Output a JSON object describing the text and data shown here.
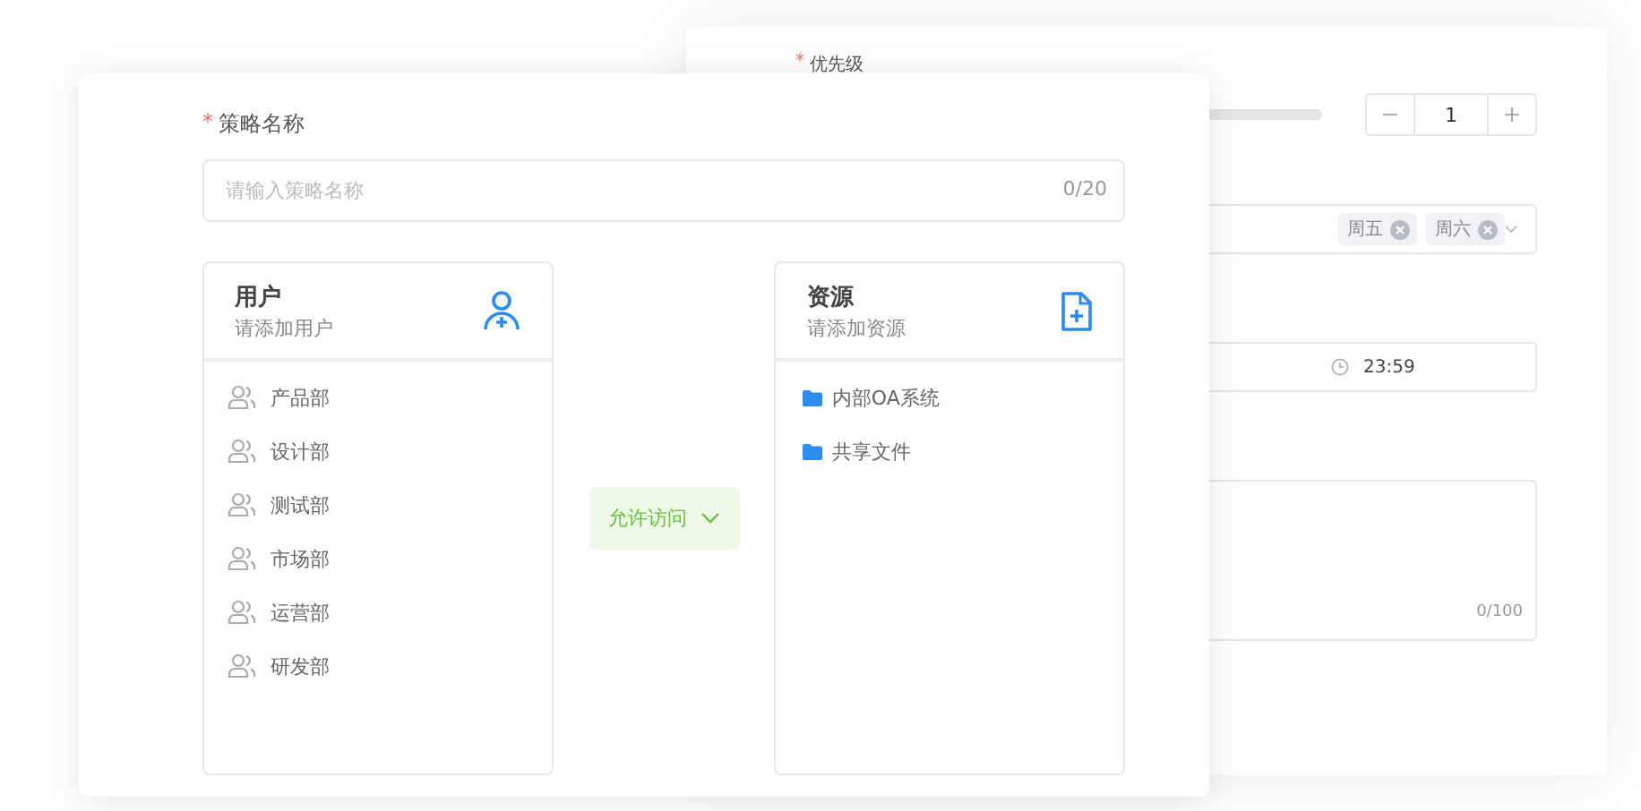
{
  "back_panel": {
    "priority_label": {
      "mark": "*",
      "text": "优先级"
    },
    "stepper": {
      "value": "1"
    },
    "day_tags": [
      {
        "label": "周五"
      },
      {
        "label": "周六"
      }
    ],
    "end_time": "23:59",
    "note_count": "0/100"
  },
  "policy_form": {
    "name_label": {
      "mark": "*",
      "text": "策略名称"
    },
    "name_field": {
      "placeholder": "请输入策略名称",
      "count": "0/20"
    },
    "users": {
      "title": "用户",
      "subtitle": "请添加用户",
      "items": [
        "产品部",
        "设计部",
        "测试部",
        "市场部",
        "运营部",
        "研发部"
      ]
    },
    "action": {
      "label": "允许访问"
    },
    "resources": {
      "title": "资源",
      "subtitle": "请添加资源",
      "items": [
        "内部OA系统",
        "共享文件"
      ]
    }
  }
}
